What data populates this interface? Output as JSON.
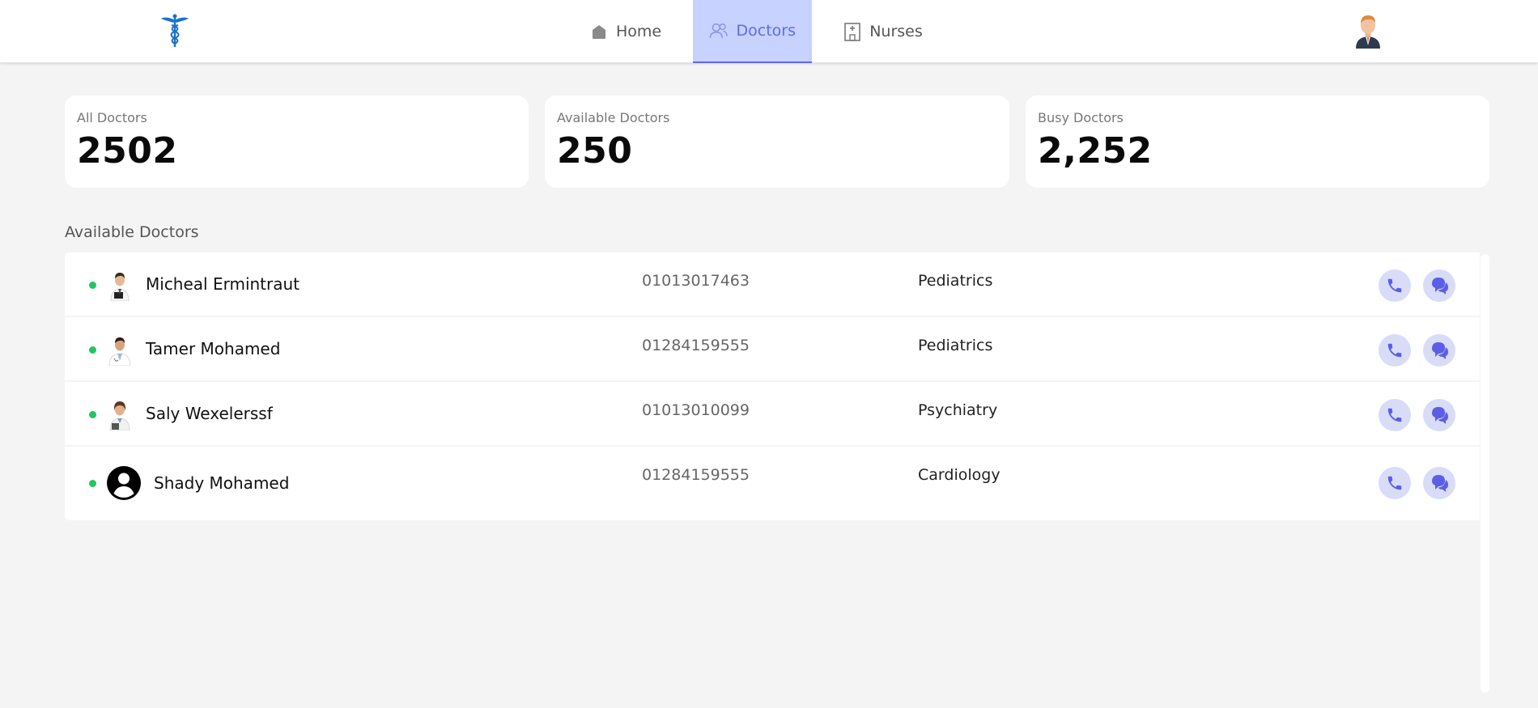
{
  "nav": {
    "items": [
      {
        "label": "Home",
        "icon": "home-icon"
      },
      {
        "label": "Doctors",
        "icon": "users-icon",
        "active": true
      },
      {
        "label": "Nurses",
        "icon": "hospital-icon"
      }
    ]
  },
  "stats": {
    "all": {
      "label": "All Doctors",
      "value": "2502"
    },
    "available": {
      "label": "Available Doctors",
      "value": "250"
    },
    "busy": {
      "label": "Busy Doctors",
      "value": "2,252"
    }
  },
  "section_title": "Available Doctors",
  "doctors": [
    {
      "name": "Micheal Ermintraut",
      "phone": "01013017463",
      "department": "Pediatrics",
      "status": "available"
    },
    {
      "name": "Tamer Mohamed",
      "phone": "01284159555",
      "department": "Pediatrics",
      "status": "available"
    },
    {
      "name": "Saly Wexelerssf",
      "phone": "01013010099",
      "department": "Psychiatry",
      "status": "available"
    },
    {
      "name": "Shady Mohamed",
      "phone": "01284159555",
      "department": "Cardiology",
      "status": "available"
    }
  ],
  "colors": {
    "accent": "#6366f1",
    "active_tab_bg": "#c7d2fe",
    "status_online": "#22c55e",
    "action_button_bg": "#d8dcf7"
  }
}
